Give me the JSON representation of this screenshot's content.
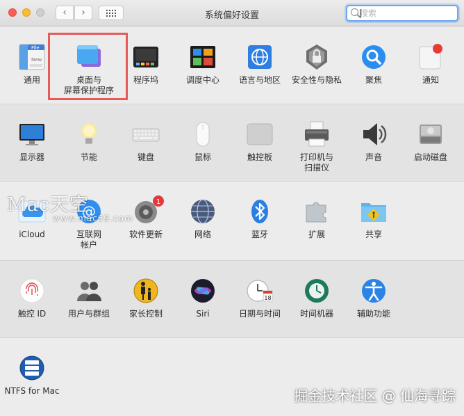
{
  "window": {
    "title": "系统偏好设置",
    "back_label": "‹",
    "forward_label": "›"
  },
  "search": {
    "placeholder": "搜索",
    "value": ""
  },
  "rows": {
    "r1": [
      {
        "label": "通用",
        "icon": "general-icon"
      },
      {
        "label": "桌面与\n屏幕保护程序",
        "icon": "desktop-screensaver-icon",
        "highlighted": true
      },
      {
        "label": "程序坞",
        "icon": "dock-icon"
      },
      {
        "label": "调度中心",
        "icon": "mission-control-icon"
      },
      {
        "label": "语言与地区",
        "icon": "language-region-icon"
      },
      {
        "label": "安全性与隐私",
        "icon": "security-privacy-icon"
      },
      {
        "label": "聚焦",
        "icon": "spotlight-icon"
      },
      {
        "label": "通知",
        "icon": "notifications-icon"
      }
    ],
    "r2": [
      {
        "label": "显示器",
        "icon": "displays-icon"
      },
      {
        "label": "节能",
        "icon": "energy-saver-icon"
      },
      {
        "label": "键盘",
        "icon": "keyboard-icon"
      },
      {
        "label": "鼠标",
        "icon": "mouse-icon"
      },
      {
        "label": "触控板",
        "icon": "trackpad-icon"
      },
      {
        "label": "打印机与\n扫描仪",
        "icon": "printers-scanners-icon"
      },
      {
        "label": "声音",
        "icon": "sound-icon"
      },
      {
        "label": "启动磁盘",
        "icon": "startup-disk-icon"
      }
    ],
    "r3": [
      {
        "label": "iCloud",
        "icon": "icloud-icon"
      },
      {
        "label": "互联网\n帐户",
        "icon": "internet-accounts-icon"
      },
      {
        "label": "软件更新",
        "icon": "software-update-icon",
        "badge": "1"
      },
      {
        "label": "网络",
        "icon": "network-icon"
      },
      {
        "label": "蓝牙",
        "icon": "bluetooth-icon"
      },
      {
        "label": "扩展",
        "icon": "extensions-icon"
      },
      {
        "label": "共享",
        "icon": "sharing-icon"
      }
    ],
    "r4": [
      {
        "label": "触控 ID",
        "icon": "touch-id-icon"
      },
      {
        "label": "用户与群组",
        "icon": "users-groups-icon"
      },
      {
        "label": "家长控制",
        "icon": "parental-controls-icon"
      },
      {
        "label": "Siri",
        "icon": "siri-icon"
      },
      {
        "label": "日期与时间",
        "icon": "date-time-icon"
      },
      {
        "label": "时间机器",
        "icon": "time-machine-icon"
      },
      {
        "label": "辅助功能",
        "icon": "accessibility-icon"
      }
    ],
    "r5": [
      {
        "label": "NTFS for Mac",
        "icon": "ntfs-for-mac-icon"
      }
    ]
  },
  "general_icon_text": {
    "top": "File",
    "bottom": "New"
  },
  "date_icon_text": {
    "day": "18"
  },
  "watermark": {
    "line1": "Mac天空",
    "line2": "www.mac69.com"
  },
  "corner_watermark": "掘金技术社区 @ 仙海寻踪",
  "colors": {
    "highlight": "#e8595a",
    "badge": "#e23a3a",
    "search_focus": "#6aa7ee"
  }
}
